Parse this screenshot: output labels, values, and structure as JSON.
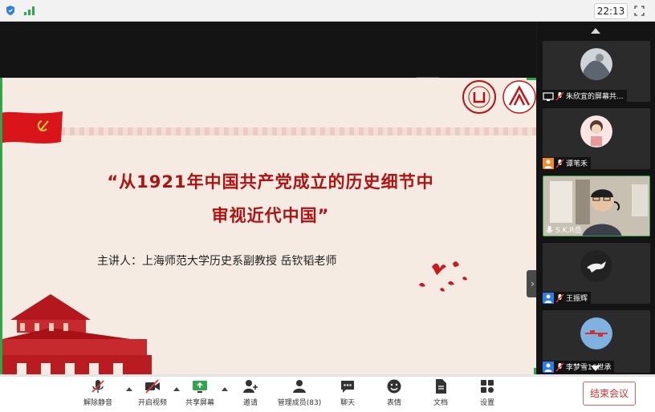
{
  "status_bar": {
    "time": "22:13"
  },
  "slide": {
    "title_line1": "“从1921年中国共产党成立的历史细节中",
    "title_line2": "审视近代中国”",
    "lecturer": "主讲人：上海师范大学历史系副教授  岳钦韬老师"
  },
  "participants": [
    {
      "name": "朱欣宜的屏幕共...",
      "type": "screen-share"
    },
    {
      "name": "谭苇禾",
      "type": "avatar"
    },
    {
      "name": "S.K.R岳",
      "type": "video"
    },
    {
      "name": "王振辉",
      "type": "avatar"
    },
    {
      "name": "李梦雪16世承",
      "type": "avatar"
    }
  ],
  "toolbar": {
    "unmute_label": "解除静音",
    "start_video_label": "开启视频",
    "share_screen_label": "共享屏幕",
    "invite_label": "邀请",
    "manage_members_label": "管理成员(83)",
    "chat_label": "聊天",
    "reactions_label": "表情",
    "documents_label": "文档",
    "settings_label": "设置",
    "end_meeting_label": "结束会议"
  },
  "colors": {
    "accent_green": "#2fa64a",
    "slide_red": "#b01212",
    "end_red": "#d43030"
  }
}
